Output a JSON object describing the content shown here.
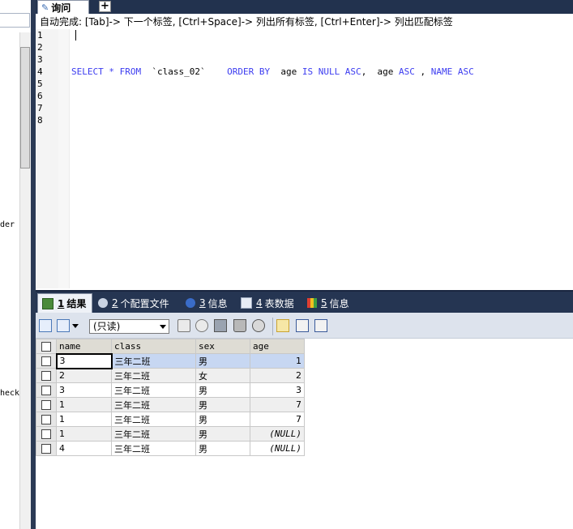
{
  "left_pane": {
    "fragment_1": "der",
    "fragment_2": "heck"
  },
  "tabs": [
    {
      "label": "询问"
    }
  ],
  "add_tab_label": "+",
  "hint": "自动完成: [Tab]-> 下一个标签, [Ctrl+Space]-> 列出所有标签, [Ctrl+Enter]-> 列出匹配标签",
  "line_numbers": [
    "1",
    "2",
    "3",
    "4",
    "5",
    "6",
    "7",
    "8"
  ],
  "sql": {
    "t1": "SELECT",
    "t2": " * ",
    "t3": "FROM",
    "t4": "  `class_02`    ",
    "t5": "ORDER BY",
    "t6": "  age ",
    "t7": "IS NULL ASC",
    "t8": ",  age ",
    "t9": "ASC",
    "t10": " , ",
    "t11": "NAME ASC"
  },
  "result_tabs": [
    {
      "num": "1",
      "label": "结果"
    },
    {
      "num": "2",
      "label": "个配置文件"
    },
    {
      "num": "3",
      "label": "信息"
    },
    {
      "num": "4",
      "label": "表数据"
    },
    {
      "num": "5",
      "label": "信息"
    }
  ],
  "toolbar": {
    "readonly_label": "(只读)"
  },
  "grid": {
    "columns": [
      "name",
      "class",
      "sex",
      "age"
    ],
    "rows": [
      [
        "3",
        "三年二班",
        "男",
        "1"
      ],
      [
        "2",
        "三年二班",
        "女",
        "2"
      ],
      [
        "3",
        "三年二班",
        "男",
        "3"
      ],
      [
        "1",
        "三年二班",
        "男",
        "7"
      ],
      [
        "1",
        "三年二班",
        "男",
        "7"
      ],
      [
        "1",
        "三年二班",
        "男",
        "(NULL)"
      ],
      [
        "4",
        "三年二班",
        "男",
        "(NULL)"
      ]
    ]
  },
  "colors": {
    "accent": "#3c3cf0",
    "dark_bar": "#22324e",
    "selection": "#c7d7f2"
  }
}
